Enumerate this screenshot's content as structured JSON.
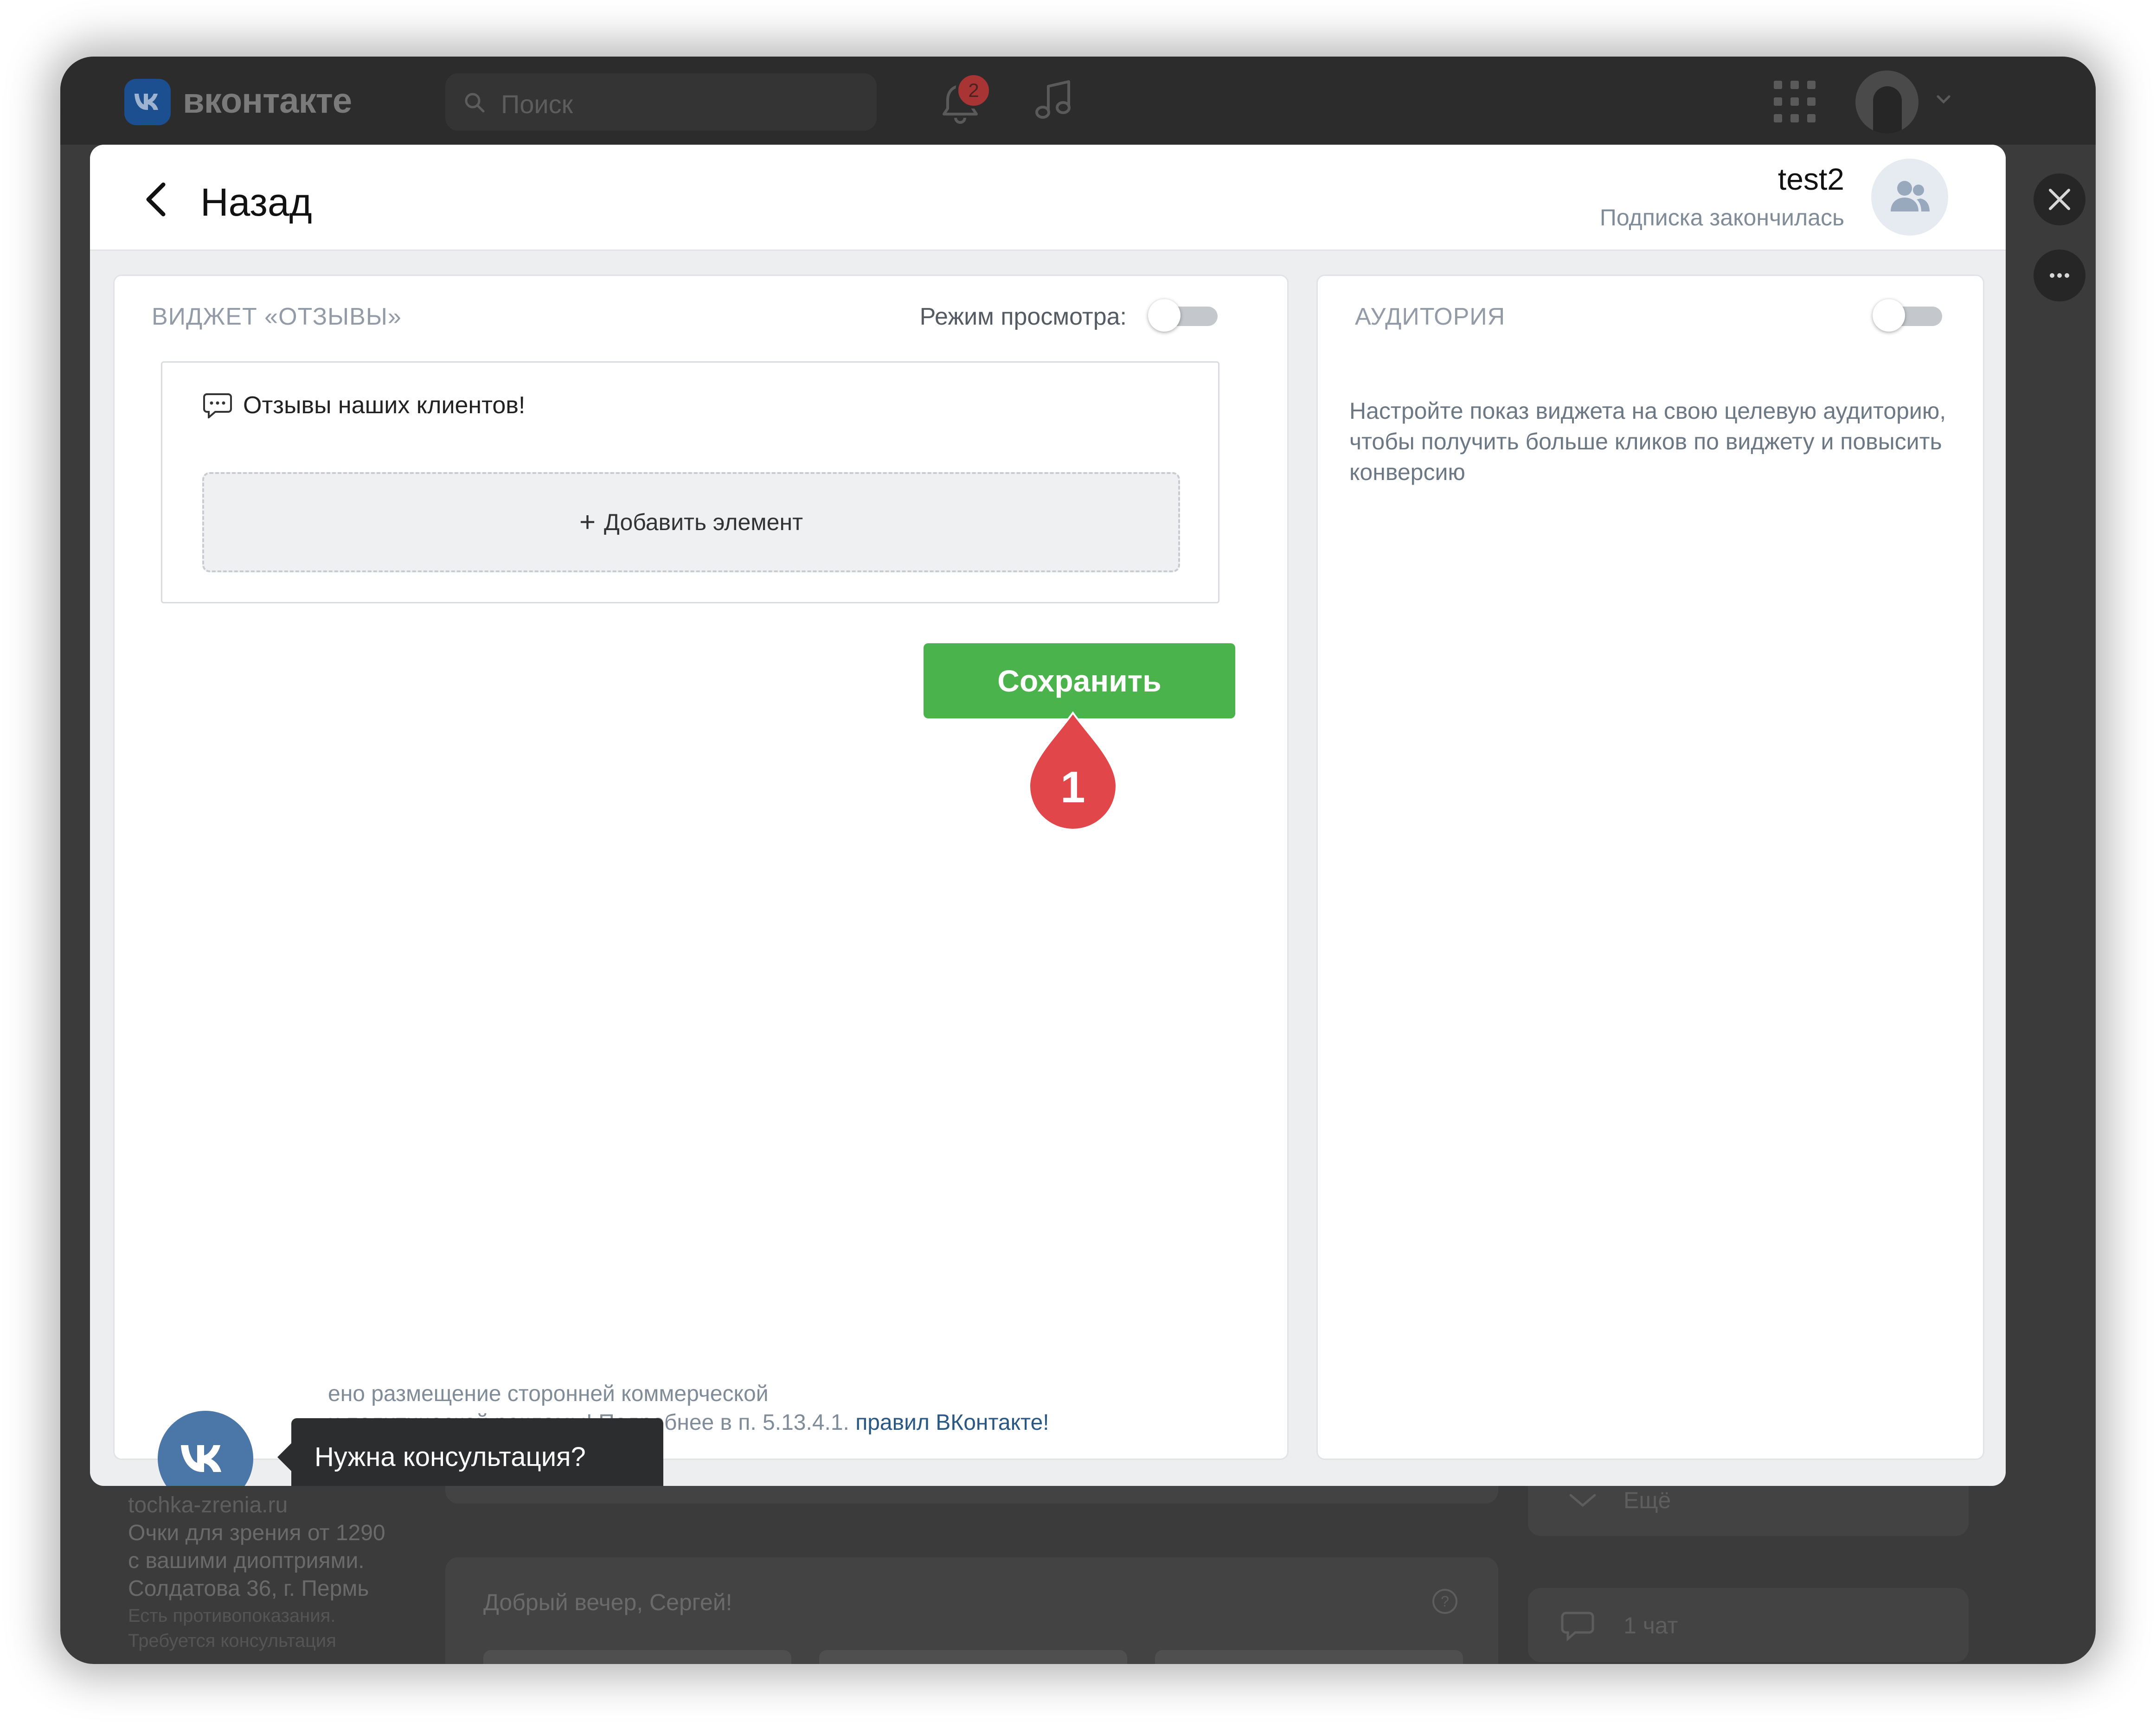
{
  "topbar": {
    "brand": "вконтакте",
    "search_placeholder": "Поиск",
    "notifications_count": "2",
    "icons": [
      "vk-logo-icon",
      "search-icon",
      "bell-icon",
      "music-icon",
      "apps-grid-icon",
      "avatar",
      "chevron-down-icon"
    ]
  },
  "side_buttons": [
    "close-icon",
    "more-icon"
  ],
  "modal": {
    "back_label": "Назад",
    "community": {
      "name": "test2",
      "status": "Подписка закончилась",
      "avatar_icon": "users-icon"
    },
    "widget_panel": {
      "title": "ВИДЖЕТ «ОТЗЫВЫ»",
      "preview_mode_label": "Режим просмотра:",
      "preview_mode_on": false,
      "widget_heading": "Отзывы наших клиентов!",
      "widget_heading_icon": "comment-icon",
      "add_element_label": "Добавить элемент",
      "save_label": "Сохранить",
      "step_marker": "1",
      "footer_line1": "ено размещение сторонней коммерческой",
      "footer_line2_prefix": "и политической рекламы! Подробнее в п. 5.13.4.1.",
      "footer_link": "правил ВКонтакте!"
    },
    "audience_panel": {
      "title": "АУДИТОРИЯ",
      "toggle_on": false,
      "description": "Настройте показ виджета на свою целевую аудиторию, чтобы получить больше кликов по виджету и повысить конверсию"
    }
  },
  "consultation": {
    "tooltip": "Нужна консультация?",
    "icon": "vk-logo-icon"
  },
  "background_page": {
    "ad_domain": "tochka-zrenia.ru",
    "ad_line1": "Очки для зрения от 1290",
    "ad_line2": "с вашими диоптриями.",
    "ad_line3": "Солдатова 36, г. Пермь",
    "ad_disclaimer1": "Есть противопоказания.",
    "ad_disclaimer2": "Требуется консультация",
    "greeting": "Добрый вечер, Сергей!",
    "more_label": "Ещё",
    "chats_label": "1 чат"
  },
  "colors": {
    "accent_green": "#4bb34b",
    "vk_blue": "#4a76a8",
    "marker_red": "#e0464a",
    "link_blue": "#2a5885"
  }
}
